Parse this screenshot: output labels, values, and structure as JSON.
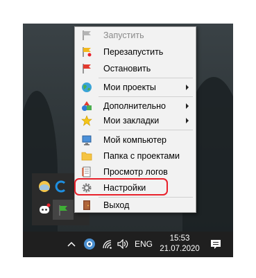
{
  "menu": {
    "items": [
      {
        "label": "Запустить",
        "icon": "flag-gray-icon",
        "disabled": true
      },
      {
        "label": "Перезапустить",
        "icon": "flag-yellow-icon"
      },
      {
        "label": "Остановить",
        "icon": "flag-red-icon"
      },
      {
        "label": "Мои проекты",
        "icon": "globe-icon",
        "submenu": true
      },
      {
        "label": "Дополнительно",
        "icon": "shapes-icon",
        "submenu": true
      },
      {
        "label": "Мои закладки",
        "icon": "star-icon",
        "submenu": true
      },
      {
        "label": "Мой компьютер",
        "icon": "computer-icon"
      },
      {
        "label": "Папка с проектами",
        "icon": "folder-icon"
      },
      {
        "label": "Просмотр логов",
        "icon": "log-icon"
      },
      {
        "label": "Настройки",
        "icon": "gear-icon",
        "highlighted": true
      },
      {
        "label": "Выход",
        "icon": "exit-door-icon"
      }
    ]
  },
  "taskbar": {
    "language": "ENG",
    "time": "15:53",
    "date": "21.07.2020"
  },
  "colors": {
    "highlight_border": "#e8202a",
    "menu_background": "#f2f2f2",
    "taskbar_background": "#1f1f1f"
  }
}
